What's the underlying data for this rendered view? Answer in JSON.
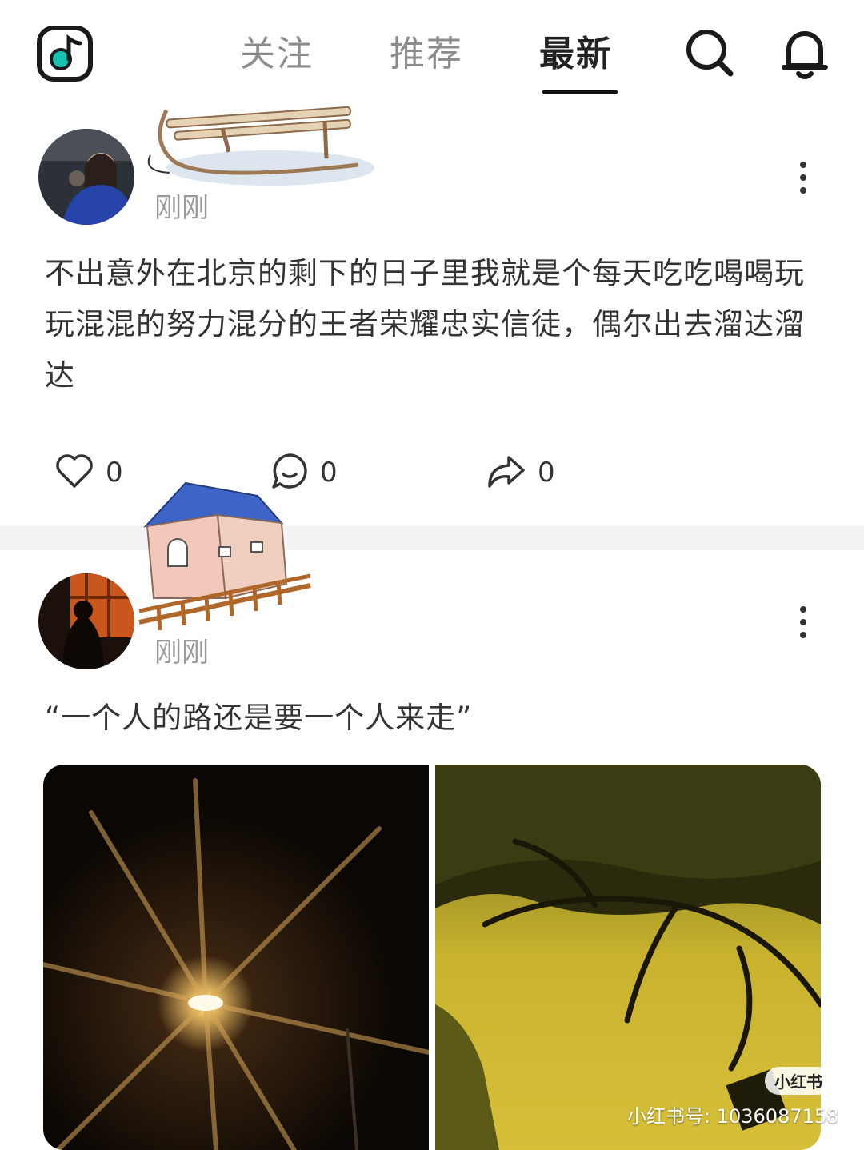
{
  "header": {
    "tabs": [
      {
        "label": "关注",
        "active": false
      },
      {
        "label": "推荐",
        "active": false
      },
      {
        "label": "最新",
        "active": true
      }
    ],
    "icons": {
      "logo": "music-note-icon",
      "search": "search-icon",
      "notifications": "bell-icon"
    }
  },
  "posts": [
    {
      "timestamp": "刚刚",
      "text": "不出意外在北京的剩下的日子里我就是个每天吃吃喝喝玩玩混混的努力混分的王者荣耀忠实信徒，偶尔出去溜达溜达",
      "actions": {
        "likes": "0",
        "comments": "0",
        "shares": "0"
      },
      "sticker": "sled-sticker"
    },
    {
      "timestamp": "刚刚",
      "text": "“一个人的路还是要一个人来走”",
      "sticker": "house-sticker",
      "images": [
        "street-lamp-photo",
        "tree-path-photo"
      ],
      "watermark": {
        "badge": "小红书",
        "id": "小红书号: 1036087158"
      }
    }
  ],
  "colors": {
    "accent_logo": "#18c3b1",
    "text": "#333333",
    "muted": "#9a9a9a"
  }
}
